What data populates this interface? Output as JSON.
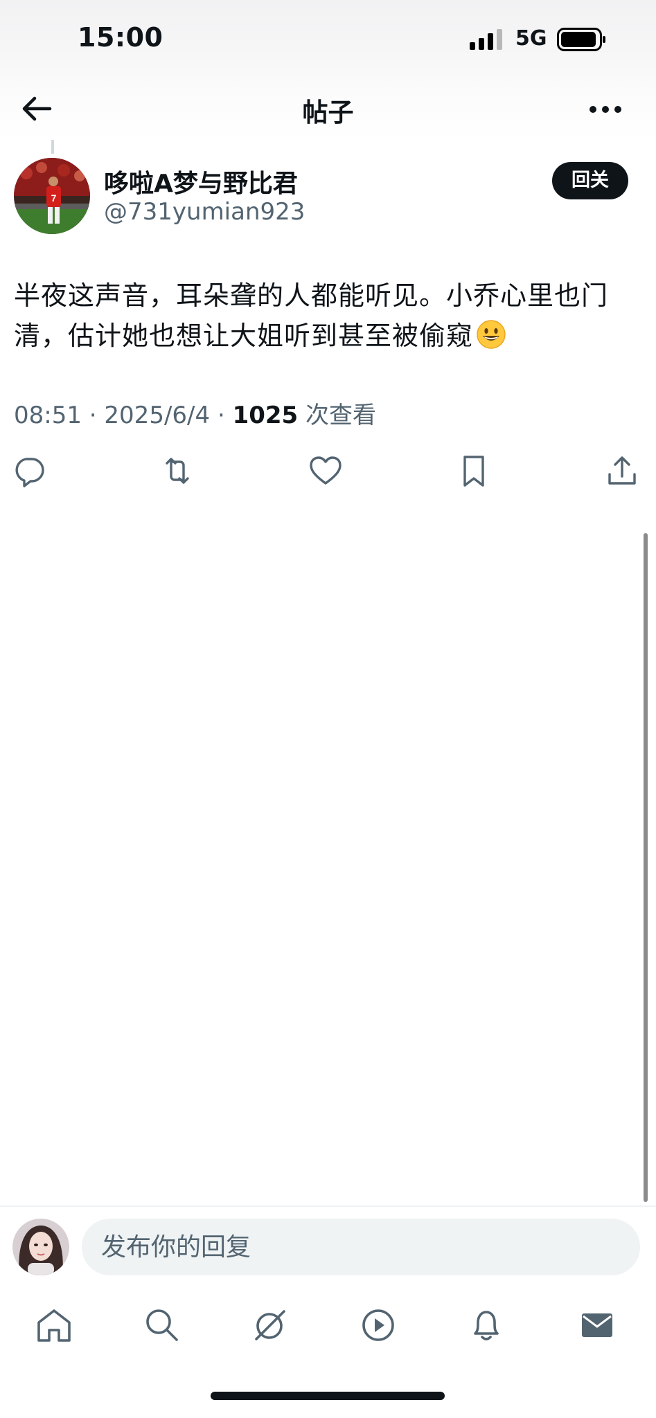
{
  "status_bar": {
    "time": "15:00",
    "network": "5G"
  },
  "header": {
    "title": "帖子"
  },
  "post": {
    "author": {
      "name": "哆啦A梦与野比君",
      "handle": "@731yumian923"
    },
    "follow_label": "回关",
    "text": "半夜这声音，耳朵聋的人都能听见。小乔心里也门清，估计她也想让大姐听到甚至被偷窥",
    "time": "08:51",
    "separator": "·",
    "date": "2025/6/4",
    "views_count": "1025",
    "views_label": "次查看"
  },
  "actions": [
    "reply-icon",
    "repost-icon",
    "like-icon",
    "bookmark-icon",
    "share-icon"
  ],
  "reply_box": {
    "placeholder": "发布你的回复"
  },
  "tabs": [
    "home-icon",
    "search-icon",
    "grok-icon",
    "video-icon",
    "notifications-icon",
    "messages-icon"
  ],
  "colors": {
    "text_primary": "#0f1419",
    "text_secondary": "#536471",
    "follow_button": "#0f1419",
    "input_bg": "#eff3f4"
  }
}
